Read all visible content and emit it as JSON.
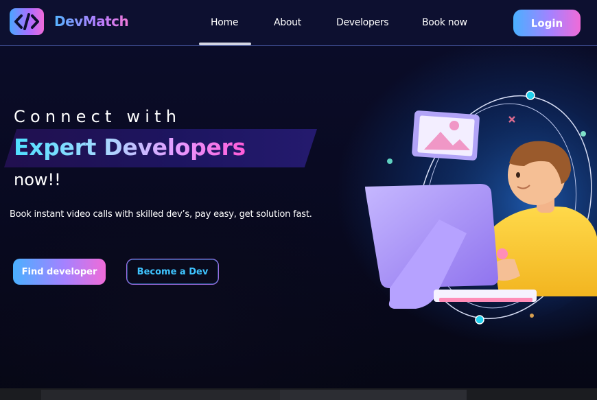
{
  "brand": {
    "name": "DevMatch"
  },
  "nav": {
    "items": [
      {
        "label": "Home"
      },
      {
        "label": "About"
      },
      {
        "label": "Developers"
      },
      {
        "label": "Book now"
      }
    ],
    "active": "Home",
    "login_label": "Login"
  },
  "hero": {
    "line1": "Connect with",
    "line2": "Expert Developers",
    "line3": "now!!",
    "subtitle": "Book instant video calls with skilled dev’s, pay easy, get solution fast.",
    "primary_cta": "Find developer",
    "secondary_cta": "Become a Dev"
  },
  "colors": {
    "background": "#08091f",
    "accent_blue": "#4ab0ff",
    "accent_purple": "#a482ff",
    "accent_pink": "#f06bd8",
    "outline_text": "#3fc4ff"
  },
  "icons": {
    "logo": "code-brackets-icon",
    "illustration": "developer-at-computer-illustration"
  }
}
